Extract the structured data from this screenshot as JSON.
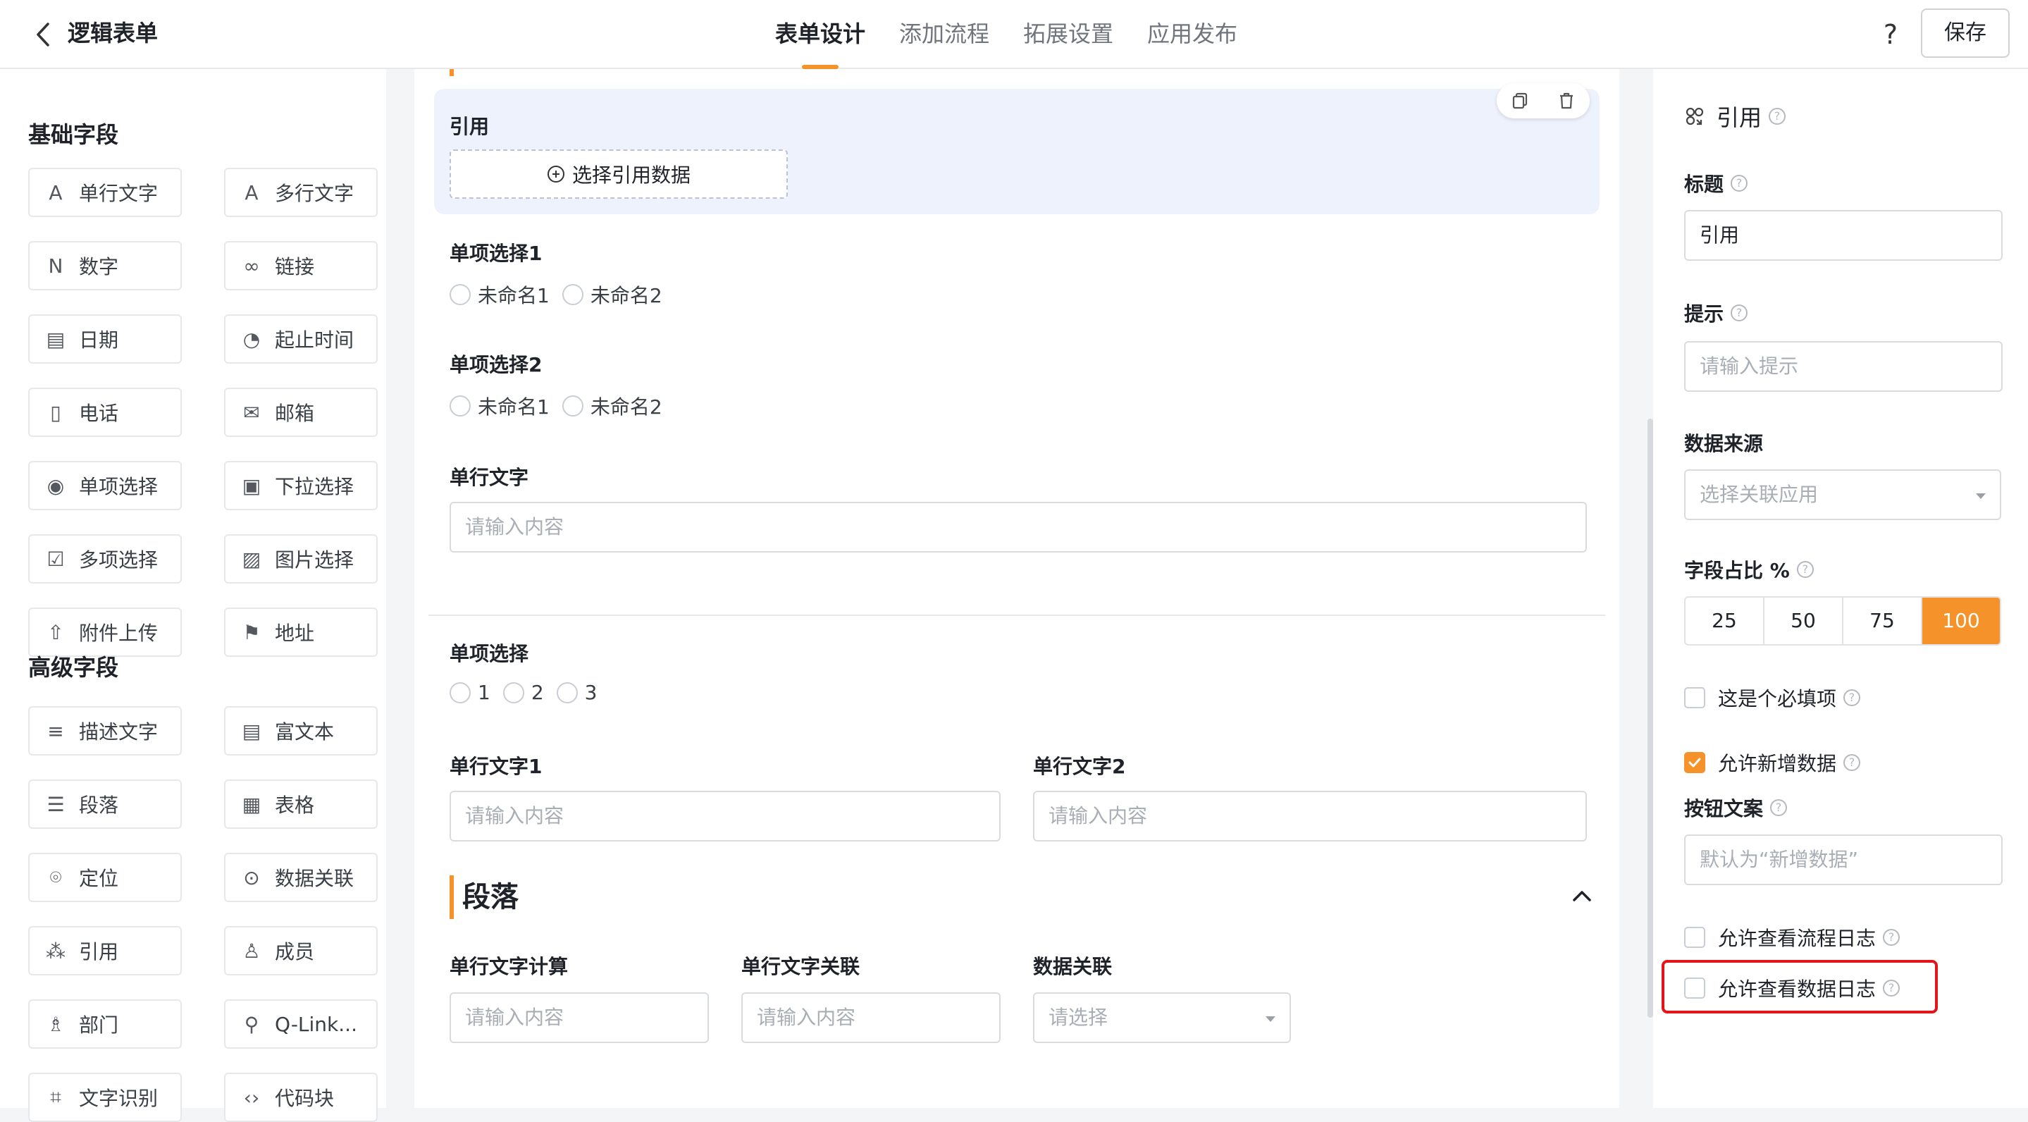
{
  "header": {
    "title": "逻辑表单",
    "tabs": [
      "表单设计",
      "添加流程",
      "拓展设置",
      "应用发布"
    ],
    "active_tab": "表单设计",
    "save_label": "保存",
    "help_label": "?"
  },
  "left": {
    "basic_title": "基础字段",
    "basic_fields": [
      {
        "label": "单行文字",
        "icon": "text-line-icon"
      },
      {
        "label": "多行文字",
        "icon": "text-multiline-icon"
      },
      {
        "label": "数字",
        "icon": "number-icon"
      },
      {
        "label": "链接",
        "icon": "link-icon"
      },
      {
        "label": "日期",
        "icon": "calendar-icon"
      },
      {
        "label": "起止时间",
        "icon": "time-range-icon"
      },
      {
        "label": "电话",
        "icon": "phone-icon"
      },
      {
        "label": "邮箱",
        "icon": "mail-icon"
      },
      {
        "label": "单项选择",
        "icon": "radio-icon"
      },
      {
        "label": "下拉选择",
        "icon": "dropdown-icon"
      },
      {
        "label": "多项选择",
        "icon": "checkbox-icon"
      },
      {
        "label": "图片选择",
        "icon": "image-icon"
      },
      {
        "label": "附件上传",
        "icon": "upload-icon"
      },
      {
        "label": "地址",
        "icon": "address-icon"
      }
    ],
    "advanced_title": "高级字段",
    "advanced_fields": [
      {
        "label": "描述文字",
        "icon": "description-icon"
      },
      {
        "label": "富文本",
        "icon": "rich-text-icon"
      },
      {
        "label": "段落",
        "icon": "paragraph-icon"
      },
      {
        "label": "表格",
        "icon": "table-icon"
      },
      {
        "label": "定位",
        "icon": "location-icon"
      },
      {
        "label": "数据关联",
        "icon": "data-link-icon"
      },
      {
        "label": "引用",
        "icon": "reference-icon"
      },
      {
        "label": "成员",
        "icon": "member-icon"
      },
      {
        "label": "部门",
        "icon": "department-icon"
      },
      {
        "label": "Q-Link...",
        "icon": "qlink-icon"
      },
      {
        "label": "文字识别",
        "icon": "ocr-icon"
      },
      {
        "label": "代码块",
        "icon": "code-icon"
      }
    ]
  },
  "canvas": {
    "ref_label": "引用",
    "ref_button": "选择引用数据",
    "radio1_label": "单项选择1",
    "radio1_options": [
      "未命名1",
      "未命名2"
    ],
    "radio2_label": "单项选择2",
    "radio2_options": [
      "未命名1",
      "未命名2"
    ],
    "text_label": "单行文字",
    "text_placeholder": "请输入内容",
    "radio3_label": "单项选择",
    "radio3_options": [
      "1",
      "2",
      "3"
    ],
    "text1_label": "单行文字1",
    "text1_placeholder": "请输入内容",
    "text2_label": "单行文字2",
    "text2_placeholder": "请输入内容",
    "paragraph_title": "段落",
    "calc_label": "单行文字计算",
    "calc_placeholder": "请输入内容",
    "assoc_label": "单行文字关联",
    "assoc_placeholder": "请输入内容",
    "datalink_label": "数据关联",
    "datalink_placeholder": "请选择"
  },
  "props": {
    "field_type": "引用",
    "title_label": "标题",
    "title_value": "引用",
    "hint_label": "提示",
    "hint_placeholder": "请输入提示",
    "source_label": "数据来源",
    "source_placeholder": "选择关联应用",
    "ratio_label": "字段占比 %",
    "ratio_options": [
      "25",
      "50",
      "75",
      "100"
    ],
    "ratio_selected": "100",
    "required_label": "这是个必填项",
    "required_checked": false,
    "allow_add_label": "允许新增数据",
    "allow_add_checked": true,
    "button_text_label": "按钮文案",
    "button_text_placeholder": "默认为“新增数据”",
    "flow_log_label": "允许查看流程日志",
    "flow_log_checked": false,
    "data_log_label": "允许查看数据日志",
    "data_log_checked": false
  },
  "colors": {
    "accent": "#f5922a",
    "highlight": "#e5141b",
    "selected_block": "#eef2fd"
  }
}
